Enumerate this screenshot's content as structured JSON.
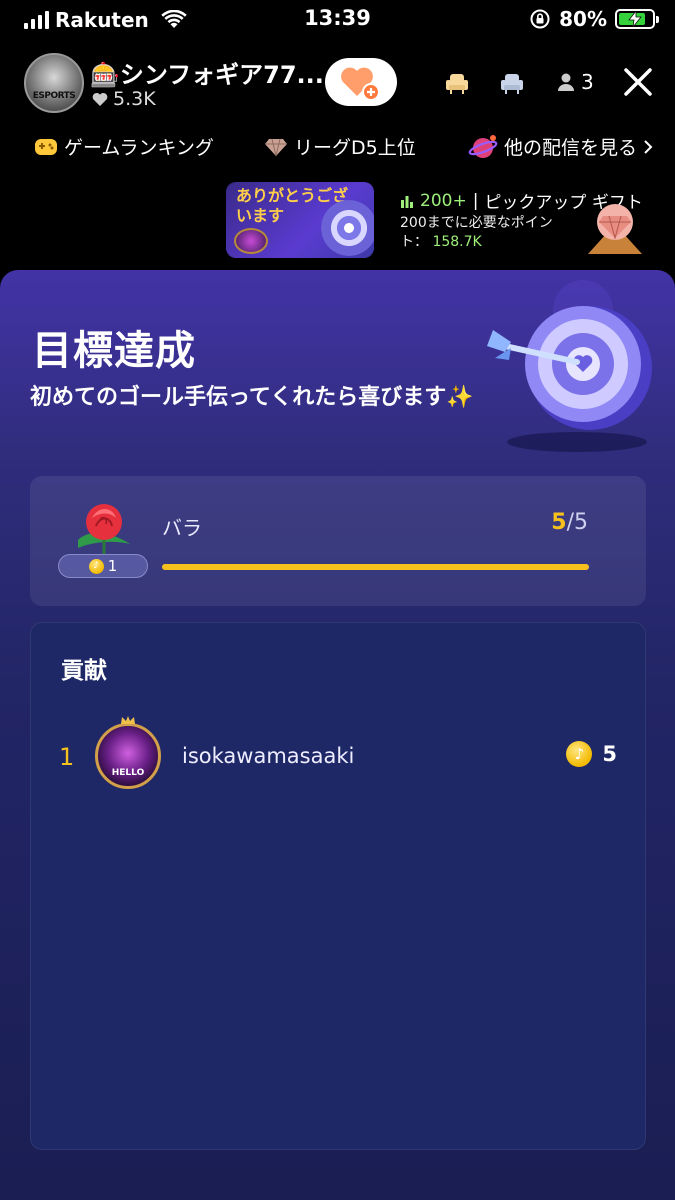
{
  "status": {
    "carrier": "Rakuten",
    "time": "13:39",
    "battery": "80%",
    "battery_level": 0.8
  },
  "header": {
    "host_badge": "ESPORTS",
    "host_name": "🎰シンフォギア77...",
    "likes": "5.3K",
    "viewers": "3"
  },
  "chips": [
    "ゲームランキング",
    "リーグD5上位",
    "他の配信を見る"
  ],
  "banner_a": {
    "text": "ありがとうございます"
  },
  "banner_b": {
    "count": "200+",
    "title": "ピックアップ ギフト",
    "desc": "200までに必要なポイント：",
    "points": "158.7K"
  },
  "goal": {
    "title": "目標達成",
    "subtitle": "初めてのゴール手伝ってくれたら喜びます✨",
    "gift_name": "バラ",
    "gift_cost": "1",
    "current": "5",
    "total": "/5",
    "progress": 1.0
  },
  "contrib": {
    "title": "貢献",
    "rows": [
      {
        "rank": "1",
        "avatar_text": "HELLO",
        "username": "isokawamasaaki",
        "coins": "5"
      }
    ]
  },
  "colors": {
    "accent_gold": "#f6c11d",
    "sheet_top": "#4333a6",
    "sheet_bottom": "#1a1e52",
    "green_stat": "#9ef07a"
  }
}
